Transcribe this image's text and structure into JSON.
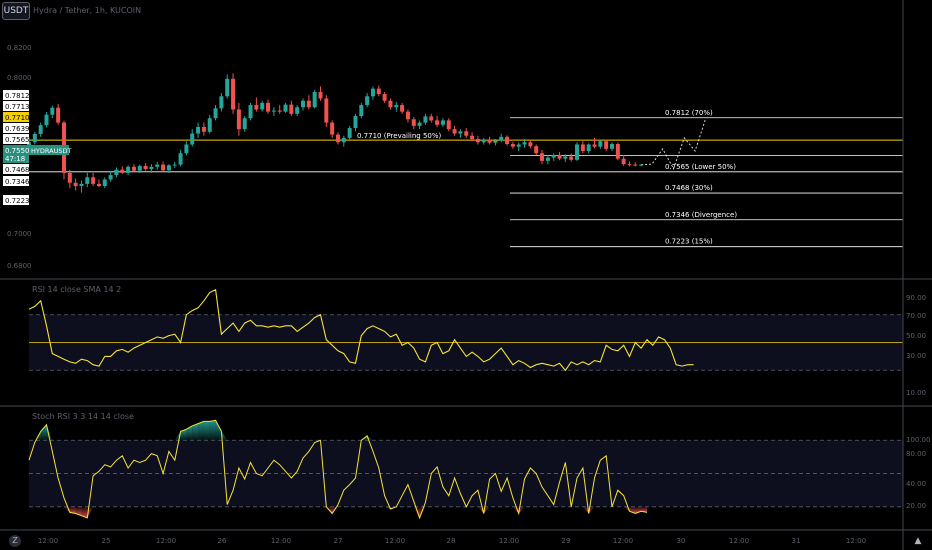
{
  "toolbar": {
    "currency_button": "USDT",
    "bottom_left_button": "Z",
    "scroll_up_label": "▲"
  },
  "symbol_title": "Hydra / Tether, 1h, KUCOIN",
  "colors": {
    "up": "#26a69a",
    "down": "#ef5350",
    "indicator": "#f5e23a",
    "level_line": "#ffffff",
    "prevailing_line": "#f5d000",
    "panel_bg": "#000000",
    "band": "#0d0f1e",
    "divider": "#434651",
    "label_active": "#2a8f7f"
  },
  "price_axis": {
    "ticks": [
      "0.8200",
      "0.8000",
      "0.7000",
      "0.6800"
    ],
    "labels": [
      {
        "text": "0.7812",
        "style": "white"
      },
      {
        "text": "0.7713",
        "style": "white"
      },
      {
        "text": "0.7710",
        "style": "yellow"
      },
      {
        "text": "0.7639",
        "style": "white"
      },
      {
        "text": "0.7565",
        "style": "white"
      },
      {
        "text": "0.7550",
        "style": "current"
      },
      {
        "text": "47:18",
        "style": "current"
      },
      {
        "text": "0.7468",
        "style": "white"
      },
      {
        "text": "0.7346",
        "style": "white"
      },
      {
        "text": "0.7223",
        "style": "white"
      }
    ],
    "symbol_tag": "HYDRAUSDT"
  },
  "levels": [
    {
      "price": 0.7812,
      "label": "0.7812 (70%)"
    },
    {
      "price": 0.771,
      "label": "0.7710 (Prevailing 50%)"
    },
    {
      "price": 0.7565,
      "label": "0.7565 (Lower 50%)"
    },
    {
      "price": 0.7468,
      "label": "0.7468 (30%)"
    },
    {
      "price": 0.7346,
      "label": "0.7346 (Divergence)"
    },
    {
      "price": 0.7223,
      "label": "0.7223 (15%)"
    }
  ],
  "rsi_panel": {
    "title": "RSI 14 close SMA 14 2",
    "ticks": [
      "90.00",
      "70.00",
      "50.00",
      "30.00",
      "10.00"
    ]
  },
  "stoch_panel": {
    "title": "Stoch RSI 3 3 14 14 close",
    "ticks": [
      "100.00",
      "80.00",
      "40.00",
      "20.00"
    ]
  },
  "time_axis": {
    "ticks": [
      "12:00",
      "25",
      "12:00",
      "26",
      "12:00",
      "27",
      "12:00",
      "28",
      "12:00",
      "29",
      "12:00",
      "30",
      "12:00",
      "31",
      "12:00"
    ]
  },
  "chart_data": [
    {
      "type": "candlestick",
      "title": "",
      "xlabel": "",
      "ylabel": "",
      "ylim": [
        0.708,
        0.835
      ],
      "candles": [
        [
          0.7668,
          0.772,
          0.7655,
          0.77
        ],
        [
          0.77,
          0.7748,
          0.769,
          0.7738
        ],
        [
          0.7738,
          0.779,
          0.7725,
          0.7778
        ],
        [
          0.7778,
          0.7838,
          0.7768,
          0.7826
        ],
        [
          0.7826,
          0.7868,
          0.781,
          0.7858
        ],
        [
          0.7858,
          0.7875,
          0.778,
          0.779
        ],
        [
          0.779,
          0.7798,
          0.753,
          0.756
        ],
        [
          0.756,
          0.7575,
          0.749,
          0.7515
        ],
        [
          0.7515,
          0.7535,
          0.748,
          0.75
        ],
        [
          0.75,
          0.7525,
          0.747,
          0.751
        ],
        [
          0.751,
          0.756,
          0.7495,
          0.754
        ],
        [
          0.754,
          0.756,
          0.75,
          0.751
        ],
        [
          0.751,
          0.753,
          0.7495,
          0.75
        ],
        [
          0.75,
          0.754,
          0.749,
          0.753
        ],
        [
          0.753,
          0.7565,
          0.752,
          0.755
        ],
        [
          0.755,
          0.7585,
          0.754,
          0.7575
        ],
        [
          0.7575,
          0.759,
          0.7555,
          0.756
        ],
        [
          0.756,
          0.7595,
          0.755,
          0.7588
        ],
        [
          0.7588,
          0.76,
          0.7565,
          0.757
        ],
        [
          0.757,
          0.7598,
          0.756,
          0.7592
        ],
        [
          0.7592,
          0.7605,
          0.757,
          0.7578
        ],
        [
          0.7578,
          0.76,
          0.756,
          0.7588
        ],
        [
          0.7588,
          0.761,
          0.7575,
          0.7598
        ],
        [
          0.7598,
          0.7612,
          0.7565,
          0.7572
        ],
        [
          0.7572,
          0.76,
          0.756,
          0.7595
        ],
        [
          0.7595,
          0.761,
          0.7582,
          0.7598
        ],
        [
          0.7598,
          0.7665,
          0.759,
          0.765
        ],
        [
          0.765,
          0.7705,
          0.764,
          0.769
        ],
        [
          0.769,
          0.776,
          0.768,
          0.774
        ],
        [
          0.774,
          0.779,
          0.772,
          0.777
        ],
        [
          0.777,
          0.779,
          0.773,
          0.7748
        ],
        [
          0.7748,
          0.7825,
          0.774,
          0.781
        ],
        [
          0.781,
          0.787,
          0.78,
          0.7855
        ],
        [
          0.7855,
          0.7925,
          0.784,
          0.791
        ],
        [
          0.791,
          0.801,
          0.79,
          0.799
        ],
        [
          0.799,
          0.8015,
          0.783,
          0.785
        ],
        [
          0.785,
          0.788,
          0.773,
          0.776
        ],
        [
          0.776,
          0.782,
          0.7748,
          0.781
        ],
        [
          0.781,
          0.788,
          0.78,
          0.787
        ],
        [
          0.787,
          0.7905,
          0.784,
          0.785
        ],
        [
          0.785,
          0.789,
          0.784,
          0.788
        ],
        [
          0.788,
          0.7895,
          0.783,
          0.784
        ],
        [
          0.784,
          0.786,
          0.782,
          0.7845
        ],
        [
          0.7845,
          0.787,
          0.783,
          0.784
        ],
        [
          0.784,
          0.788,
          0.7835,
          0.7872
        ],
        [
          0.7872,
          0.789,
          0.782,
          0.783
        ],
        [
          0.783,
          0.787,
          0.782,
          0.786
        ],
        [
          0.786,
          0.79,
          0.7845,
          0.789
        ],
        [
          0.789,
          0.7915,
          0.785,
          0.786
        ],
        [
          0.786,
          0.794,
          0.7855,
          0.793
        ],
        [
          0.793,
          0.7955,
          0.789,
          0.79
        ],
        [
          0.79,
          0.7915,
          0.777,
          0.779
        ],
        [
          0.779,
          0.78,
          0.772,
          0.7735
        ],
        [
          0.7735,
          0.7745,
          0.769,
          0.77
        ],
        [
          0.77,
          0.773,
          0.768,
          0.772
        ],
        [
          0.772,
          0.7775,
          0.771,
          0.7765
        ],
        [
          0.7765,
          0.783,
          0.775,
          0.782
        ],
        [
          0.782,
          0.788,
          0.781,
          0.787
        ],
        [
          0.787,
          0.7925,
          0.786,
          0.791
        ],
        [
          0.791,
          0.7955,
          0.7895,
          0.7945
        ],
        [
          0.7945,
          0.796,
          0.791,
          0.792
        ],
        [
          0.792,
          0.793,
          0.788,
          0.789
        ],
        [
          0.789,
          0.79,
          0.785,
          0.786
        ],
        [
          0.786,
          0.7885,
          0.784,
          0.787
        ],
        [
          0.787,
          0.788,
          0.783,
          0.784
        ],
        [
          0.784,
          0.785,
          0.779,
          0.7805
        ],
        [
          0.7805,
          0.7815,
          0.776,
          0.7775
        ],
        [
          0.7775,
          0.78,
          0.776,
          0.779
        ],
        [
          0.779,
          0.783,
          0.778,
          0.7818
        ],
        [
          0.7818,
          0.783,
          0.779,
          0.78
        ],
        [
          0.78,
          0.782,
          0.777,
          0.778
        ],
        [
          0.778,
          0.781,
          0.777,
          0.78
        ],
        [
          0.78,
          0.781,
          0.775,
          0.776
        ],
        [
          0.776,
          0.7775,
          0.773,
          0.774
        ],
        [
          0.774,
          0.776,
          0.772,
          0.775
        ],
        [
          0.775,
          0.7765,
          0.772,
          0.773
        ],
        [
          0.773,
          0.7745,
          0.7705,
          0.7715
        ],
        [
          0.7715,
          0.773,
          0.769,
          0.77
        ],
        [
          0.77,
          0.772,
          0.769,
          0.7712
        ],
        [
          0.7712,
          0.7725,
          0.769,
          0.7698
        ],
        [
          0.7698,
          0.7715,
          0.7685,
          0.7708
        ],
        [
          0.7708,
          0.774,
          0.77,
          0.7725
        ],
        [
          0.7725,
          0.7732,
          0.7685,
          0.7692
        ],
        [
          0.7692,
          0.7702,
          0.767,
          0.768
        ],
        [
          0.768,
          0.77,
          0.766,
          0.769
        ],
        [
          0.769,
          0.7715,
          0.7675,
          0.77
        ],
        [
          0.77,
          0.771,
          0.7672,
          0.7682
        ],
        [
          0.7682,
          0.769,
          0.764,
          0.765
        ],
        [
          0.765,
          0.7665,
          0.76,
          0.7615
        ],
        [
          0.7615,
          0.764,
          0.76,
          0.763
        ],
        [
          0.763,
          0.765,
          0.7615,
          0.764
        ],
        [
          0.764,
          0.7655,
          0.7618,
          0.7625
        ],
        [
          0.7625,
          0.7645,
          0.761,
          0.7635
        ],
        [
          0.7635,
          0.765,
          0.7612,
          0.762
        ],
        [
          0.762,
          0.77,
          0.7615,
          0.769
        ],
        [
          0.769,
          0.7705,
          0.765,
          0.766
        ],
        [
          0.766,
          0.7695,
          0.765,
          0.769
        ],
        [
          0.769,
          0.772,
          0.7672,
          0.768
        ],
        [
          0.768,
          0.7712,
          0.767,
          0.7705
        ],
        [
          0.7705,
          0.7712,
          0.766,
          0.767
        ],
        [
          0.767,
          0.77,
          0.766,
          0.7692
        ],
        [
          0.7692,
          0.7698,
          0.7618,
          0.7625
        ],
        [
          0.7625,
          0.764,
          0.7592,
          0.76
        ],
        [
          0.76,
          0.7612,
          0.759,
          0.7598
        ],
        [
          0.7598,
          0.7608,
          0.759,
          0.7595
        ],
        [
          0.7595,
          0.76,
          0.759,
          0.7598
        ]
      ],
      "projection": [
        0.7598,
        0.76,
        0.767,
        0.758,
        0.772,
        0.766,
        0.7812
      ]
    },
    {
      "type": "line",
      "title": "RSI 14 close SMA 14 2",
      "ylim": [
        5,
        95
      ],
      "bands": [
        30,
        70
      ],
      "midline": 50,
      "values": [
        74,
        76,
        80,
        62,
        42,
        40,
        38,
        36,
        35,
        38,
        37,
        34,
        33,
        40,
        40,
        44,
        45,
        43,
        46,
        48,
        50,
        52,
        54,
        53,
        55,
        56,
        50,
        70,
        73,
        75,
        80,
        86,
        88,
        56,
        60,
        64,
        58,
        64,
        66,
        62,
        62,
        61,
        62,
        61,
        62,
        62,
        58,
        61,
        64,
        68,
        70,
        52,
        48,
        44,
        42,
        36,
        35,
        55,
        60,
        62,
        60,
        58,
        54,
        56,
        48,
        50,
        46,
        38,
        36,
        48,
        50,
        42,
        44,
        52,
        46,
        40,
        43,
        40,
        36,
        38,
        42,
        46,
        40,
        34,
        37,
        35,
        32,
        34,
        35,
        34,
        33,
        35,
        30,
        36,
        34,
        36,
        34,
        37,
        36,
        48,
        45,
        44,
        48,
        40,
        50,
        46,
        52,
        48,
        54,
        52,
        46,
        34,
        33,
        34,
        34
      ],
      "series": []
    },
    {
      "type": "area",
      "title": "Stoch RSI 3 3 14 14 close",
      "ylim": [
        0,
        110
      ],
      "bands": [
        20,
        80
      ],
      "midline": 50,
      "values": [
        62,
        78,
        88,
        94,
        70,
        46,
        28,
        15,
        14,
        12,
        10,
        48,
        52,
        58,
        56,
        62,
        66,
        55,
        62,
        60,
        62,
        68,
        66,
        50,
        70,
        62,
        88,
        90,
        93,
        95,
        97,
        97,
        98,
        88,
        22,
        35,
        55,
        45,
        60,
        50,
        48,
        55,
        62,
        58,
        52,
        46,
        52,
        64,
        70,
        78,
        80,
        20,
        14,
        22,
        35,
        40,
        46,
        80,
        84,
        70,
        55,
        30,
        18,
        20,
        30,
        40,
        25,
        10,
        24,
        50,
        56,
        38,
        30,
        46,
        32,
        20,
        30,
        35,
        14,
        45,
        50,
        34,
        46,
        28,
        14,
        45,
        55,
        50,
        38,
        30,
        22,
        42,
        60,
        20,
        46,
        55,
        14,
        46,
        62,
        66,
        20,
        35,
        30,
        16,
        14,
        16,
        15
      ]
    }
  ]
}
